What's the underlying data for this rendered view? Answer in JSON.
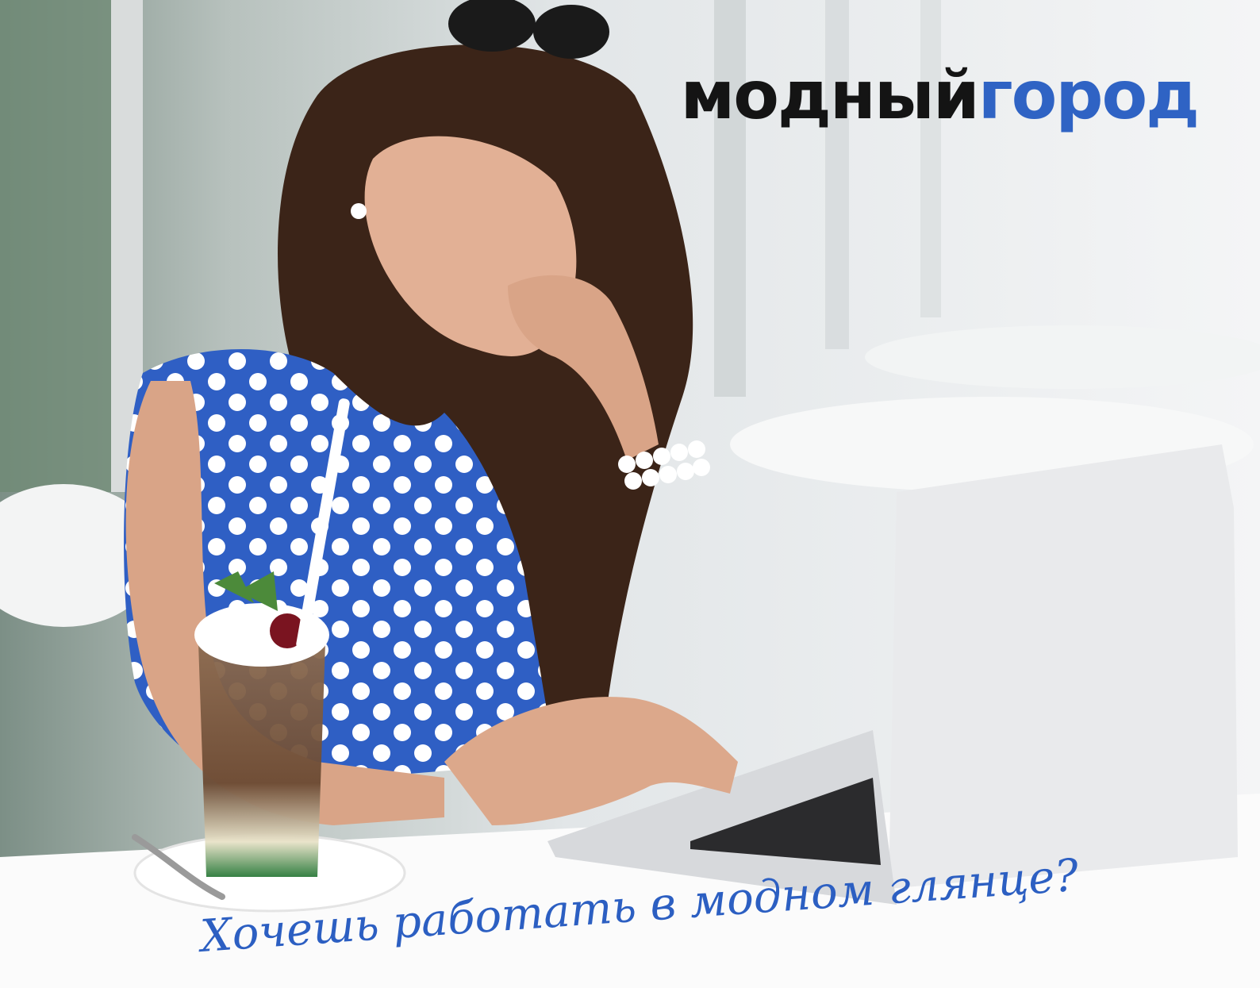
{
  "brand": {
    "word1": "модный",
    "word2": "город",
    "color_dark": "#141414",
    "color_accent": "#2f63c4"
  },
  "slogan": "Хочешь работать в модном глянце?",
  "palette": {
    "dress": "#2f5fc4",
    "hair": "#3b2418",
    "skin": "#d9a487",
    "laptop": "#e9eaec",
    "background": "#eef1f3"
  }
}
